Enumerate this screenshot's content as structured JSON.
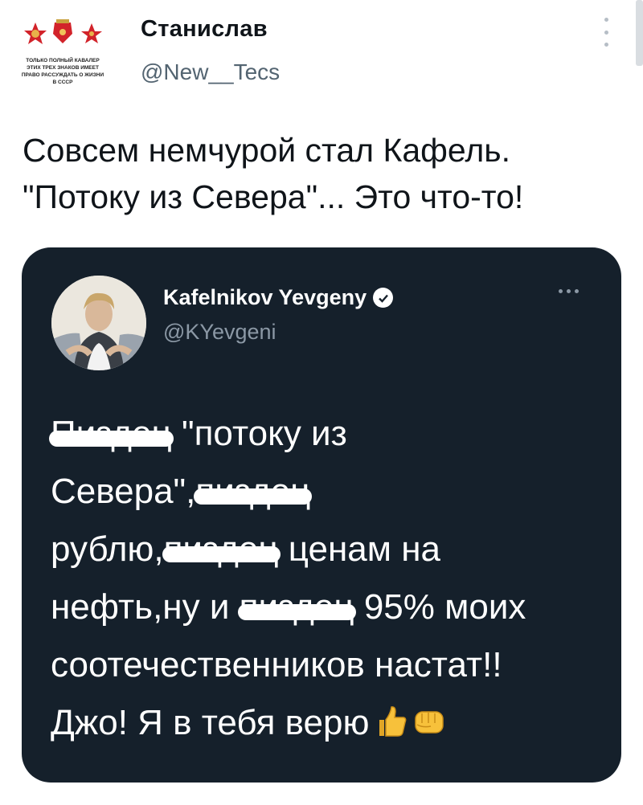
{
  "author": {
    "name": "Станислав",
    "handle": "@New__Tecs",
    "avatar_caption": [
      "ТОЛЬКО ПОЛНЫЙ КАВАЛЕР",
      "ЭТИХ ТРЕХ ЗНАКОВ ИМЕЕТ",
      "ПРАВО РАССУЖДАТЬ О ЖИЗНИ",
      "В СССР"
    ]
  },
  "tweet": {
    "lines": [
      "Совсем немчурой стал Кафель.",
      "\"Потоку из Севера\"... Это что-то!"
    ]
  },
  "quoted": {
    "name": "Kafelnikov Yevgeny",
    "handle": "@KYevgeni",
    "verified": true,
    "lines": [
      [
        {
          "t": "Пиздец",
          "c": true
        },
        {
          "t": " \"потоку из",
          "c": false
        }
      ],
      [
        {
          "t": "Севера\",",
          "c": false
        },
        {
          "t": "пиздец",
          "c": true
        }
      ],
      [
        {
          "t": "рублю,",
          "c": false
        },
        {
          "t": "пиздец",
          "c": true
        },
        {
          "t": " ценам на",
          "c": false
        }
      ],
      [
        {
          "t": "нефть,ну и ",
          "c": false
        },
        {
          "t": "пиздец",
          "c": true
        },
        {
          "t": " 95% моих",
          "c": false
        }
      ],
      [
        {
          "t": "соотечественников настат!!",
          "c": false
        }
      ],
      [
        {
          "t": "Джо! Я в тебя верю",
          "c": false
        }
      ]
    ],
    "emojis": [
      "thumbs-up-icon",
      "fist-icon"
    ]
  },
  "colors": {
    "card_bg": "#15202b",
    "handle_gray": "#536471",
    "card_handle_gray": "#8b98a5"
  }
}
